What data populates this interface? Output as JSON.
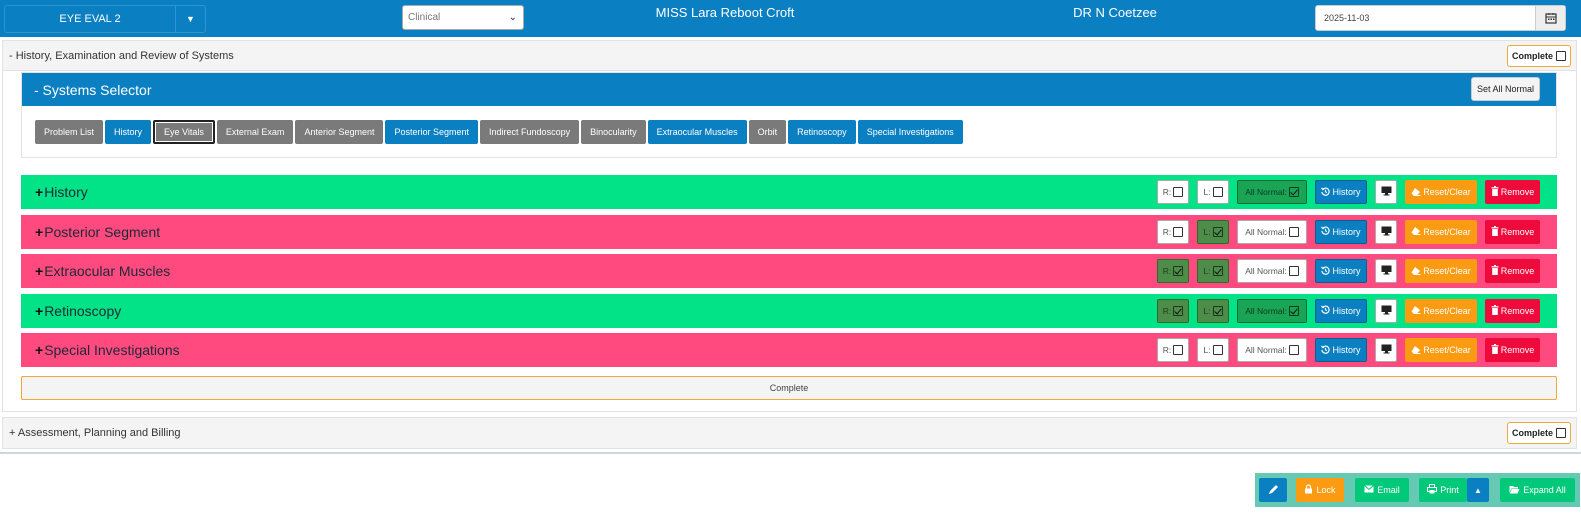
{
  "header": {
    "form_label": "EYE EVAL 2",
    "type_select": "Clinical",
    "patient_name": "MISS Lara Reboot Croft",
    "doctor_name": "DR N Coetzee",
    "date": "2025-11-03"
  },
  "section1": {
    "title": "- History, Examination and Review of Systems",
    "complete_label": "Complete"
  },
  "systems_selector": {
    "title": "- Systems Selector",
    "set_all_normal": "Set All Normal",
    "buttons": [
      {
        "label": "Problem List",
        "state": "off"
      },
      {
        "label": "History",
        "state": "on"
      },
      {
        "label": "Eye Vitals",
        "state": "active"
      },
      {
        "label": "External Exam",
        "state": "off"
      },
      {
        "label": "Anterior Segment",
        "state": "off"
      },
      {
        "label": "Posterior Segment",
        "state": "on"
      },
      {
        "label": "Indirect Fundoscopy",
        "state": "off"
      },
      {
        "label": "Binocularity",
        "state": "off"
      },
      {
        "label": "Extraocular Muscles",
        "state": "on"
      },
      {
        "label": "Orbit",
        "state": "off"
      },
      {
        "label": "Retinoscopy",
        "state": "on"
      },
      {
        "label": "Special Investigations",
        "state": "on"
      }
    ]
  },
  "rows": [
    {
      "plus": "+",
      "title": "History",
      "color": "#02e286",
      "r": false,
      "l": false,
      "all_normal": true
    },
    {
      "plus": "+",
      "title": "Posterior Segment",
      "color": "#ff4a7f",
      "r": false,
      "l": true,
      "all_normal": false
    },
    {
      "plus": "+",
      "title": "Extraocular Muscles",
      "color": "#ff4a7f",
      "r": true,
      "l": true,
      "all_normal": false
    },
    {
      "plus": "+",
      "title": "Retinoscopy",
      "color": "#02e286",
      "r": true,
      "l": true,
      "all_normal": true
    },
    {
      "plus": "+",
      "title": "Special Investigations",
      "color": "#ff4a7f",
      "r": false,
      "l": false,
      "all_normal": false
    }
  ],
  "row_controls": {
    "r_label": "R:",
    "l_label": "L:",
    "all_normal_label": "All Normal:",
    "history_label": "History",
    "reset_label": "Reset/Clear",
    "remove_label": "Remove"
  },
  "complete_bar": "Complete",
  "section2": {
    "title": "+ Assessment, Planning and Billing",
    "complete_label": "Complete"
  },
  "toolbar": {
    "lock": "Lock",
    "email": "Email",
    "print": "Print",
    "expand_all": "Expand All"
  },
  "colors": {
    "primary": "#0a7fc1",
    "normal_row": "#02e286",
    "abnormal_row": "#ff4a7f",
    "reset": "#fb9b12",
    "remove": "#ee0a3a"
  }
}
